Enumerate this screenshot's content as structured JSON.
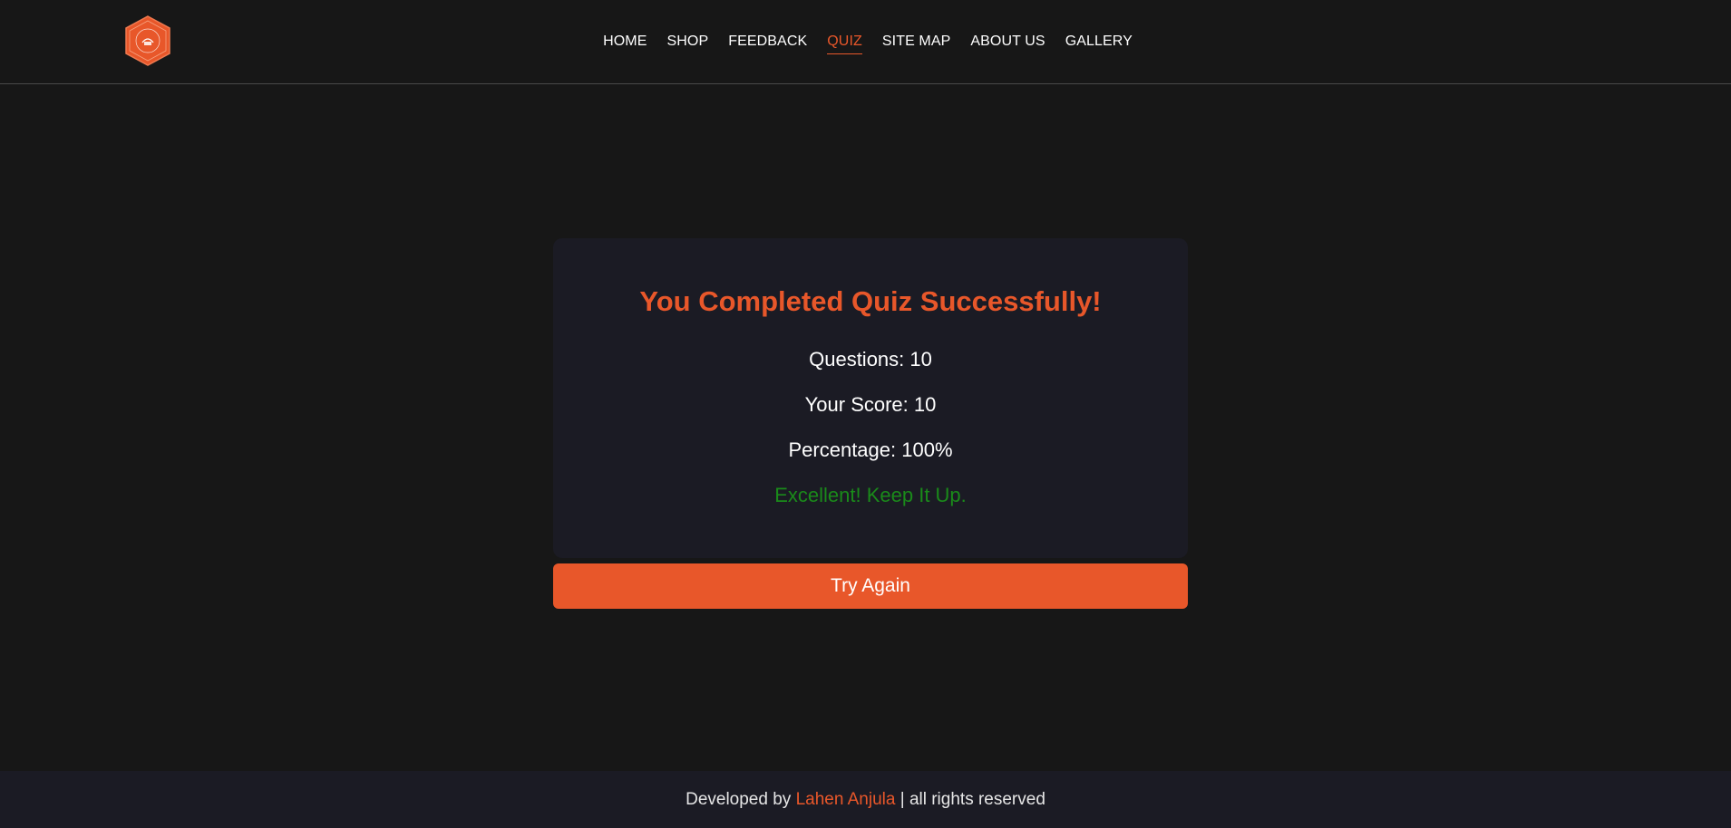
{
  "header": {
    "logo_icon": "hexagon-badge-logo-icon",
    "nav": [
      {
        "label": "HOME"
      },
      {
        "label": "SHOP"
      },
      {
        "label": "FEEDBACK"
      },
      {
        "label": "QUIZ",
        "active": true
      },
      {
        "label": "SITE MAP"
      },
      {
        "label": "ABOUT US"
      },
      {
        "label": "GALLERY"
      }
    ]
  },
  "result": {
    "title": "You Completed Quiz Successfully!",
    "questions_label": "Questions: ",
    "questions_value": "10",
    "score_label": "Your Score: ",
    "score_value": "10",
    "percentage_label": "Percentage: ",
    "percentage_value": "100%",
    "remark": "Excellent! Keep It Up.",
    "try_again_label": "Try Again"
  },
  "footer": {
    "prefix": "Developed by ",
    "developer": "Lahen Anjula",
    "suffix": " | all rights reserved"
  },
  "colors": {
    "accent": "#e8572a",
    "background": "#171717",
    "card": "#1b1b24",
    "success": "#1a8a1a"
  }
}
